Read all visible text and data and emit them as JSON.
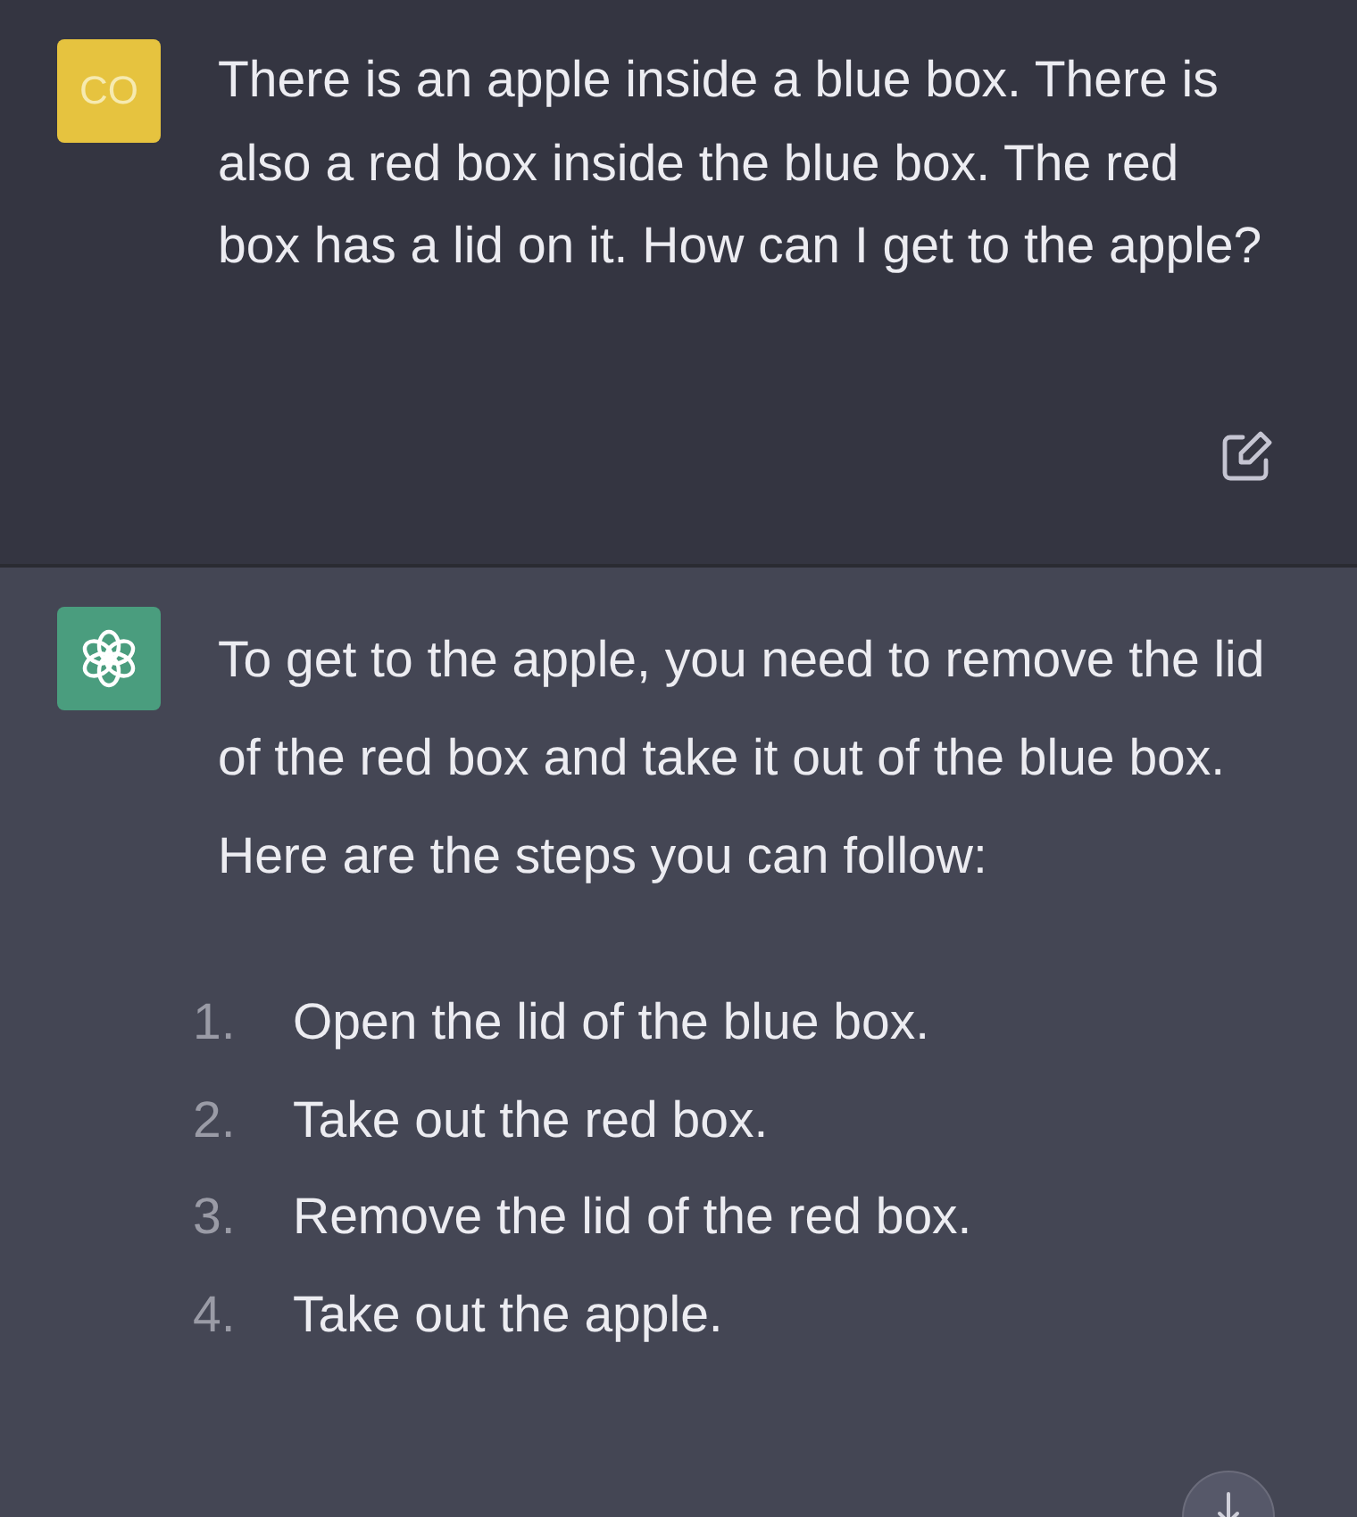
{
  "messages": [
    {
      "kind": "user",
      "avatar_text": "CO",
      "paragraphs": [
        "There is an apple inside a blue box. There is also a red box inside the blue box. The red box has a lid on it. How can I get to the apple?"
      ]
    },
    {
      "kind": "assistant",
      "paragraphs": [
        "To get to the apple, you need to remove the lid of the red box and take it out of the blue box. Here are the steps you can follow:"
      ],
      "steps": [
        {
          "number": "1.",
          "text": "Open the lid of the blue box."
        },
        {
          "number": "2.",
          "text": "Take out the red box."
        },
        {
          "number": "3.",
          "text": "Remove the lid of the red box."
        },
        {
          "number": "4.",
          "text": "Take out the apple."
        }
      ]
    }
  ]
}
